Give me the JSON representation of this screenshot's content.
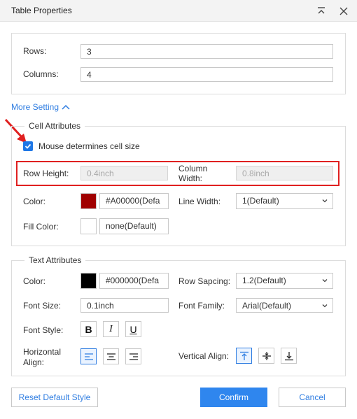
{
  "dialog": {
    "title": "Table Properties"
  },
  "table": {
    "rows_label": "Rows:",
    "rows_value": "3",
    "columns_label": "Columns:",
    "columns_value": "4"
  },
  "more_setting": "More Setting",
  "cell": {
    "legend": "Cell Attributes",
    "mouse_size_label": "Mouse determines cell size",
    "mouse_size_checked": true,
    "row_height_label": "Row Height:",
    "row_height_value": "0.4inch",
    "column_width_label_1": "Column",
    "column_width_label_2": "Width:",
    "column_width_value": "0.8inch",
    "color_label": "Color:",
    "color_swatch": "#A00000",
    "color_value": "#A00000(Defa",
    "line_width_label": "Line Width:",
    "line_width_value": "1(Default)",
    "fill_color_label": "Fill Color:",
    "fill_swatch": "#ffffff",
    "fill_value": "none(Default)"
  },
  "text": {
    "legend": "Text Attributes",
    "color_label": "Color:",
    "color_swatch": "#000000",
    "color_value": "#000000(Defa",
    "row_spacing_label": "Row Sapcing:",
    "row_spacing_value": "1.2(Default)",
    "font_size_label": "Font Size:",
    "font_size_value": "0.1inch",
    "font_family_label": "Font Family:",
    "font_family_value": "Arial(Default)",
    "font_style_label": "Font Style:",
    "bold_glyph": "B",
    "italic_glyph": "I",
    "underline_glyph": "U",
    "h_align_label_1": "Horizontal",
    "h_align_label_2": "Align:",
    "v_align_label": "Vertical Align:"
  },
  "footer": {
    "reset_label": "Reset Default Style",
    "confirm_label": "Confirm",
    "cancel_label": "Cancel"
  },
  "colors": {
    "accent": "#2f86ee",
    "highlight_border": "#e02020"
  }
}
